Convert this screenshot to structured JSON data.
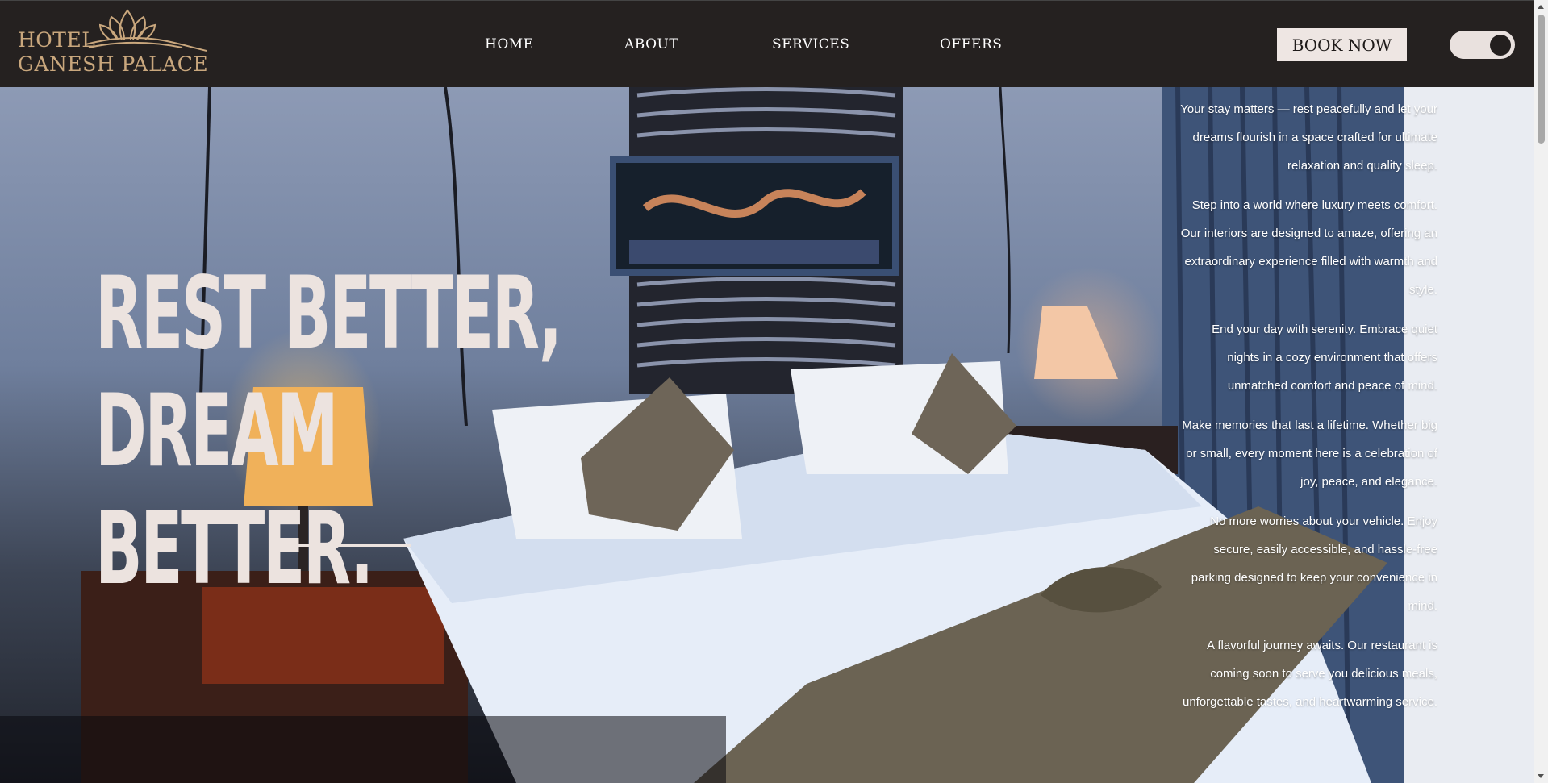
{
  "brand": {
    "line1": "HOTEL",
    "line2": "GANESH PALACE",
    "logo_icon": "lotus-icon",
    "gold": "#c9a77d"
  },
  "nav": {
    "items": [
      {
        "label": "HOME"
      },
      {
        "label": "ABOUT"
      },
      {
        "label": "SERVICES"
      },
      {
        "label": "OFFERS"
      }
    ]
  },
  "header": {
    "book_label": "BOOK NOW",
    "theme_toggle": "toggle-icon",
    "background": "#252120"
  },
  "hero": {
    "headline": [
      "REST BETTER,",
      "DREAM",
      "BETTER."
    ],
    "blurbs": [
      "Your stay matters — rest peacefully and let your dreams flourish in a space crafted for ultimate relaxation and quality sleep.",
      "Step into a world where luxury meets comfort. Our interiors are designed to amaze, offering an extraordinary experience filled with warmth and style.",
      "End your day with serenity. Embrace quiet nights in a cozy environment that offers unmatched comfort and peace of mind.",
      "Make memories that last a lifetime. Whether big or small, every moment here is a celebration of joy, peace, and elegance.",
      "No more worries about your vehicle. Enjoy secure, easily accessible, and hassle-free parking designed to keep your convenience in mind.",
      "A flavorful journey awaits. Our restaurant is coming soon to serve you delicious meals, unforgettable tastes, and heartwarming service."
    ]
  }
}
